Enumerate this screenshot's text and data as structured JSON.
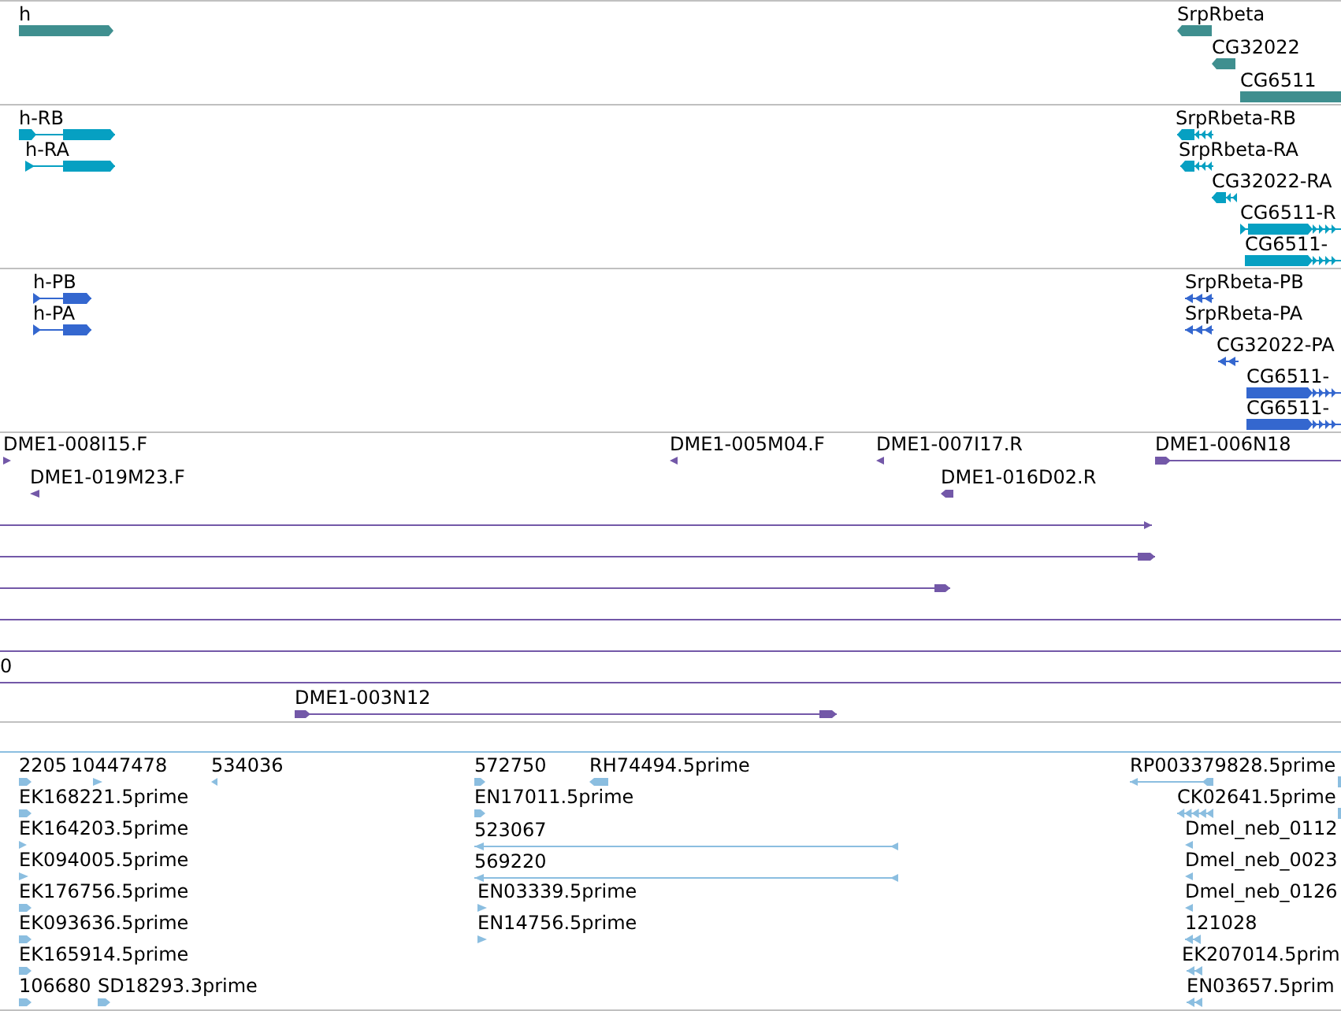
{
  "tracks": [
    {
      "color": "#3f8f8f",
      "features": [
        {
          "label": "h",
          "kind": "bar",
          "reverse": false
        },
        {
          "label": "SrpRbeta",
          "kind": "bar",
          "reverse": true
        },
        {
          "label": "CG32022",
          "kind": "bar",
          "reverse": true
        },
        {
          "label": "CG6511",
          "kind": "bar"
        }
      ]
    },
    {
      "color": "#06a0c2",
      "features": [
        {
          "label": "h-RB",
          "kind": "model",
          "reverse": false
        },
        {
          "label": "SrpRbeta-RB",
          "kind": "model",
          "reverse": true
        },
        {
          "label": "h-RA",
          "kind": "model",
          "reverse": false
        },
        {
          "label": "SrpRbeta-RA",
          "kind": "model",
          "reverse": true
        },
        {
          "label": "CG32022-RA",
          "kind": "model",
          "reverse": true
        },
        {
          "label": "CG6511-R",
          "kind": "model",
          "reverse": false
        },
        {
          "label": "CG6511-",
          "kind": "model",
          "reverse": false
        }
      ]
    },
    {
      "color": "#3467cf",
      "features": [
        {
          "label": "h-PB",
          "kind": "model",
          "reverse": false
        },
        {
          "label": "SrpRbeta-PB",
          "kind": "model",
          "reverse": true
        },
        {
          "label": "h-PA",
          "kind": "model",
          "reverse": false
        },
        {
          "label": "SrpRbeta-PA",
          "kind": "model",
          "reverse": true
        },
        {
          "label": "CG32022-PA",
          "kind": "model",
          "reverse": true
        },
        {
          "label": "CG6511-",
          "kind": "model",
          "reverse": false
        },
        {
          "label": "CG6511-",
          "kind": "model",
          "reverse": false
        }
      ]
    },
    {
      "color": "#7358a8",
      "features": [
        {
          "label": "DME1-008I15.F",
          "kind": "arrow",
          "reverse": false
        },
        {
          "label": "DME1-005M04.F",
          "kind": "arrow",
          "reverse": true
        },
        {
          "label": "DME1-007I17.R",
          "kind": "arrow",
          "reverse": true
        },
        {
          "label": "DME1-006N18",
          "kind": "line",
          "reverse": false
        },
        {
          "label": "DME1-019M23.F",
          "kind": "arrow",
          "reverse": true
        },
        {
          "label": "DME1-016D02.R",
          "kind": "arrow",
          "reverse": true
        },
        {
          "kind": "line",
          "reverse": false
        },
        {
          "kind": "line",
          "reverse": false
        },
        {
          "kind": "line",
          "reverse": false
        },
        {
          "kind": "line"
        },
        {
          "kind": "line"
        },
        {
          "label": "0",
          "kind": "line"
        },
        {
          "label": "DME1-003N12",
          "kind": "line",
          "reverse": false
        }
      ]
    },
    {
      "color": "#8bbee0",
      "features": [
        {
          "label": "2205",
          "kind": "arrow",
          "reverse": false
        },
        {
          "label": "10447478",
          "kind": "arrow",
          "reverse": false
        },
        {
          "label": "534036",
          "kind": "arrow",
          "reverse": true
        },
        {
          "label": "572750",
          "kind": "arrow",
          "reverse": false
        },
        {
          "label": "RH74494.5prime",
          "kind": "arrow",
          "reverse": true
        },
        {
          "label": "RP003379828.5prime",
          "kind": "line",
          "reverse": true
        },
        {
          "kind": "bar"
        },
        {
          "label": "EK168221.5prime",
          "kind": "arrow",
          "reverse": false
        },
        {
          "label": "EN17011.5prime",
          "kind": "arrow",
          "reverse": false
        },
        {
          "label": "CK02641.5prime",
          "kind": "arrow",
          "reverse": true
        },
        {
          "kind": "bar"
        },
        {
          "label": "EK164203.5prime",
          "kind": "arrow",
          "reverse": false
        },
        {
          "label": "523067",
          "kind": "line",
          "reverse": true
        },
        {
          "label": "Dmel_neb_0112",
          "kind": "arrow",
          "reverse": true
        },
        {
          "label": "EK094005.5prime",
          "kind": "arrow",
          "reverse": false
        },
        {
          "label": "569220",
          "kind": "line",
          "reverse": true
        },
        {
          "label": "Dmel_neb_0023",
          "kind": "arrow",
          "reverse": true
        },
        {
          "label": "EK176756.5prime",
          "kind": "arrow",
          "reverse": false
        },
        {
          "label": "EN03339.5prime",
          "kind": "arrow",
          "reverse": false
        },
        {
          "label": "Dmel_neb_0126",
          "kind": "arrow",
          "reverse": true
        },
        {
          "label": "EK093636.5prime",
          "kind": "arrow",
          "reverse": false
        },
        {
          "label": "EN14756.5prime",
          "kind": "arrow",
          "reverse": false
        },
        {
          "label": "121028",
          "kind": "arrow",
          "reverse": true
        },
        {
          "label": "EK165914.5prime",
          "kind": "arrow",
          "reverse": false
        },
        {
          "label": "EK207014.5prim",
          "kind": "arrow",
          "reverse": true
        },
        {
          "label": "106680",
          "kind": "arrow",
          "reverse": false
        },
        {
          "label": "SD18293.3prime",
          "kind": "arrow",
          "reverse": false
        },
        {
          "label": "EN03657.5prim",
          "kind": "arrow",
          "reverse": true
        }
      ]
    }
  ]
}
